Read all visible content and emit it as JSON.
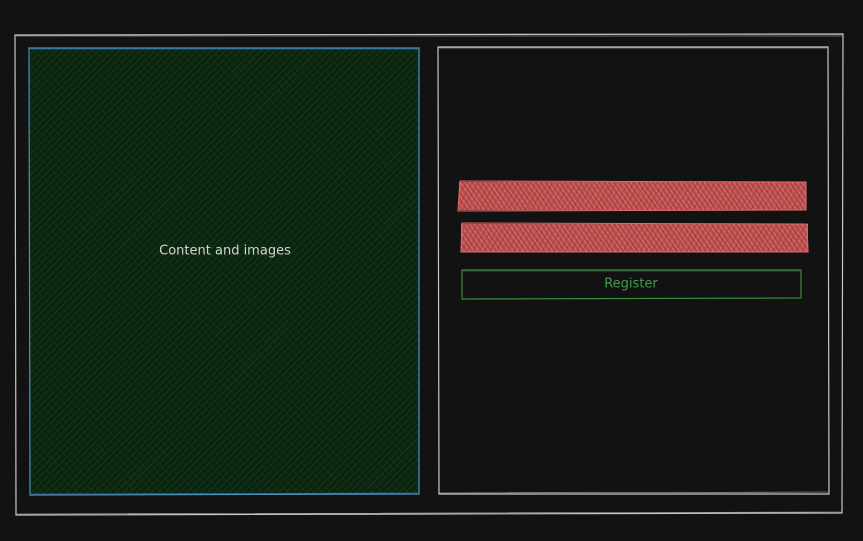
{
  "content_panel": {
    "label": "Content and images",
    "fill_color": "#0b240f",
    "stroke_color": "#4a90c8"
  },
  "form_panel": {
    "stroke_color": "#c8c8c8",
    "input_fill_color": "#e06060",
    "register_button": {
      "label": "Register",
      "stroke_color": "#3a8a3e",
      "text_color": "#3f9f4a"
    }
  },
  "outer_frame": {
    "stroke_color": "#c8c8c8"
  }
}
